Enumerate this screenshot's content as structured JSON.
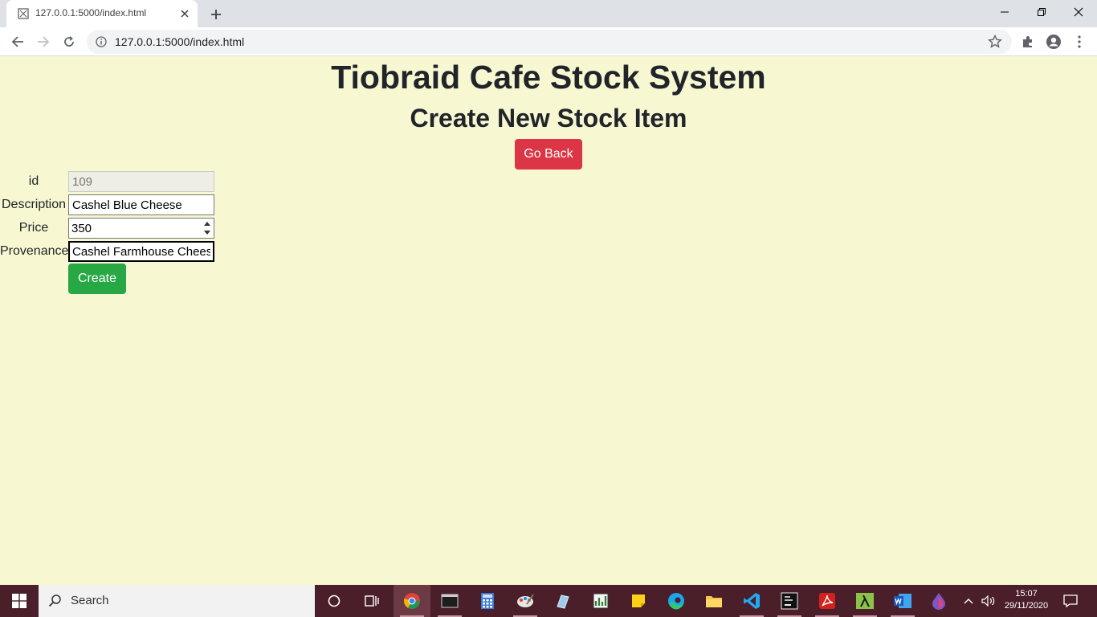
{
  "browser": {
    "tab_title": "127.0.0.1:5000/index.html",
    "url": "127.0.0.1:5000/index.html"
  },
  "page": {
    "title": "Tiobraid Cafe Stock System",
    "subtitle": "Create New Stock Item",
    "go_back_label": "Go Back",
    "create_label": "Create"
  },
  "form": {
    "id": {
      "label": "id",
      "value": "109"
    },
    "description": {
      "label": "Description",
      "value": "Cashel Blue Cheese"
    },
    "price": {
      "label": "Price",
      "value": "350"
    },
    "provenance": {
      "label": "Provenance",
      "value": "Cashel Farmhouse Chees"
    }
  },
  "taskbar": {
    "search_placeholder": "Search",
    "time": "15:07",
    "date": "29/11/2020"
  },
  "colors": {
    "background": "#f7f8d2",
    "danger": "#dc3545",
    "success": "#28a745",
    "taskbar": "#4a1f2a"
  }
}
